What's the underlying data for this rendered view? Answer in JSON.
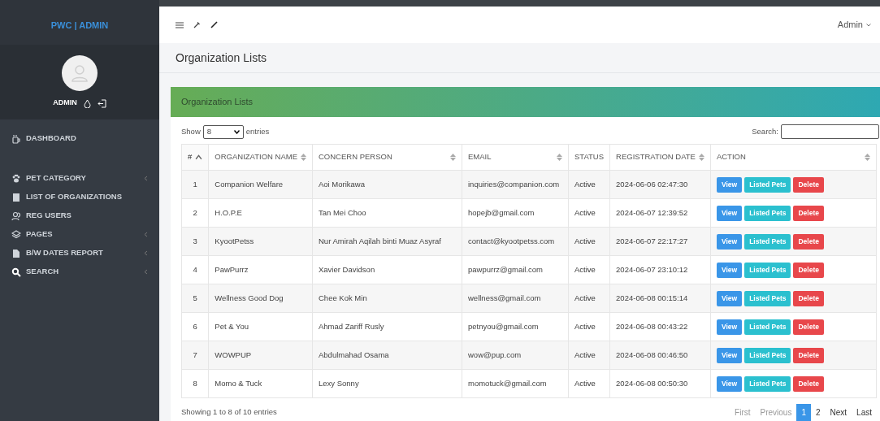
{
  "brand": "PWC | ADMIN",
  "user": {
    "name": "ADMIN"
  },
  "sidebar": {
    "items": [
      {
        "label": "DASHBOARD",
        "has_submenu": false
      },
      {
        "label": "PET CATEGORY",
        "has_submenu": true
      },
      {
        "label": "LIST OF ORGANIZATIONS",
        "has_submenu": false
      },
      {
        "label": "REG USERS",
        "has_submenu": false
      },
      {
        "label": "PAGES",
        "has_submenu": true
      },
      {
        "label": "B/W DATES REPORT",
        "has_submenu": true
      },
      {
        "label": "SEARCH",
        "has_submenu": true
      }
    ]
  },
  "topbar": {
    "user_menu": "Admin"
  },
  "page_title": "Organization Lists",
  "card": {
    "title": "Organization Lists",
    "length": {
      "before": "Show",
      "value": "8",
      "after": "entries"
    },
    "search": {
      "label": "Search:"
    },
    "table": {
      "columns": [
        {
          "label": "#",
          "sortable": true,
          "sorted": true
        },
        {
          "label": "ORGANIZATION NAME",
          "sortable": true,
          "sorted": false
        },
        {
          "label": "CONCERN PERSON",
          "sortable": true,
          "sorted": false
        },
        {
          "label": "EMAIL",
          "sortable": true,
          "sorted": false
        },
        {
          "label": "STATUS",
          "sortable": false,
          "sorted": false
        },
        {
          "label": "REGISTRATION DATE",
          "sortable": true,
          "sorted": false
        },
        {
          "label": "ACTION",
          "sortable": true,
          "sorted": false
        }
      ],
      "rows": [
        {
          "no": "1",
          "name": "Companion Welfare",
          "person": "Aoi Morikawa",
          "email": "inquiries@companion.com",
          "status": "Active",
          "date": "2024-06-06 02:47:30",
          "actions": [
            {
              "label": "View",
              "kind": "view"
            },
            {
              "label": "Listed Pets",
              "kind": "pets"
            },
            {
              "label": "Delete",
              "kind": "delete"
            }
          ]
        },
        {
          "no": "2",
          "name": "H.O.P.E",
          "person": "Tan Mei Choo",
          "email": "hopejb@gmail.com",
          "status": "Active",
          "date": "2024-06-07 12:39:52",
          "actions": [
            {
              "label": "View",
              "kind": "view"
            },
            {
              "label": "Listed Pets",
              "kind": "pets"
            },
            {
              "label": "Delete",
              "kind": "delete"
            }
          ]
        },
        {
          "no": "3",
          "name": "KyootPetss",
          "person": "Nur Amirah Aqilah binti Muaz Asyraf",
          "email": "contact@kyootpetss.com",
          "status": "Active",
          "date": "2024-06-07 22:17:27",
          "actions": [
            {
              "label": "View",
              "kind": "view"
            },
            {
              "label": "Listed Pets",
              "kind": "pets"
            },
            {
              "label": "Delete",
              "kind": "delete"
            }
          ]
        },
        {
          "no": "4",
          "name": "PawPurrz",
          "person": "Xavier Davidson",
          "email": "pawpurrz@gmail.com",
          "status": "Active",
          "date": "2024-06-07 23:10:12",
          "actions": [
            {
              "label": "View",
              "kind": "view"
            },
            {
              "label": "Listed Pets",
              "kind": "pets"
            },
            {
              "label": "Delete",
              "kind": "delete"
            }
          ]
        },
        {
          "no": "5",
          "name": "Wellness Good Dog",
          "person": "Chee Kok Min",
          "email": "wellness@gmail.com",
          "status": "Active",
          "date": "2024-06-08 00:15:14",
          "actions": [
            {
              "label": "View",
              "kind": "view"
            },
            {
              "label": "Listed Pets",
              "kind": "pets"
            },
            {
              "label": "Delete",
              "kind": "delete"
            }
          ]
        },
        {
          "no": "6",
          "name": "Pet & You",
          "person": "Ahmad Zariff Rusly",
          "email": "petnyou@gmail.com",
          "status": "Active",
          "date": "2024-06-08 00:43:22",
          "actions": [
            {
              "label": "View",
              "kind": "view"
            },
            {
              "label": "Listed Pets",
              "kind": "pets"
            },
            {
              "label": "Delete",
              "kind": "delete"
            }
          ]
        },
        {
          "no": "7",
          "name": "WOWPUP",
          "person": "Abdulmahad Osama",
          "email": "wow@pup.com",
          "status": "Active",
          "date": "2024-06-08 00:46:50",
          "actions": [
            {
              "label": "View",
              "kind": "view"
            },
            {
              "label": "Listed Pets",
              "kind": "pets"
            },
            {
              "label": "Delete",
              "kind": "delete"
            }
          ]
        },
        {
          "no": "8",
          "name": "Momo & Tuck",
          "person": "Lexy Sonny",
          "email": "momotuck@gmail.com",
          "status": "Active",
          "date": "2024-06-08 00:50:30",
          "actions": [
            {
              "label": "View",
              "kind": "view"
            },
            {
              "label": "Listed Pets",
              "kind": "pets"
            },
            {
              "label": "Delete",
              "kind": "delete"
            }
          ]
        }
      ]
    },
    "info": "Showing 1 to 8 of 10 entries",
    "pagination": [
      {
        "label": "First",
        "selected": false,
        "disabled": true
      },
      {
        "label": "Previous",
        "selected": false,
        "disabled": true
      },
      {
        "label": "1",
        "selected": true,
        "disabled": false
      },
      {
        "label": "2",
        "selected": false,
        "disabled": false
      },
      {
        "label": "Next",
        "selected": false,
        "disabled": false
      },
      {
        "label": "Last",
        "selected": false,
        "disabled": false
      }
    ]
  }
}
